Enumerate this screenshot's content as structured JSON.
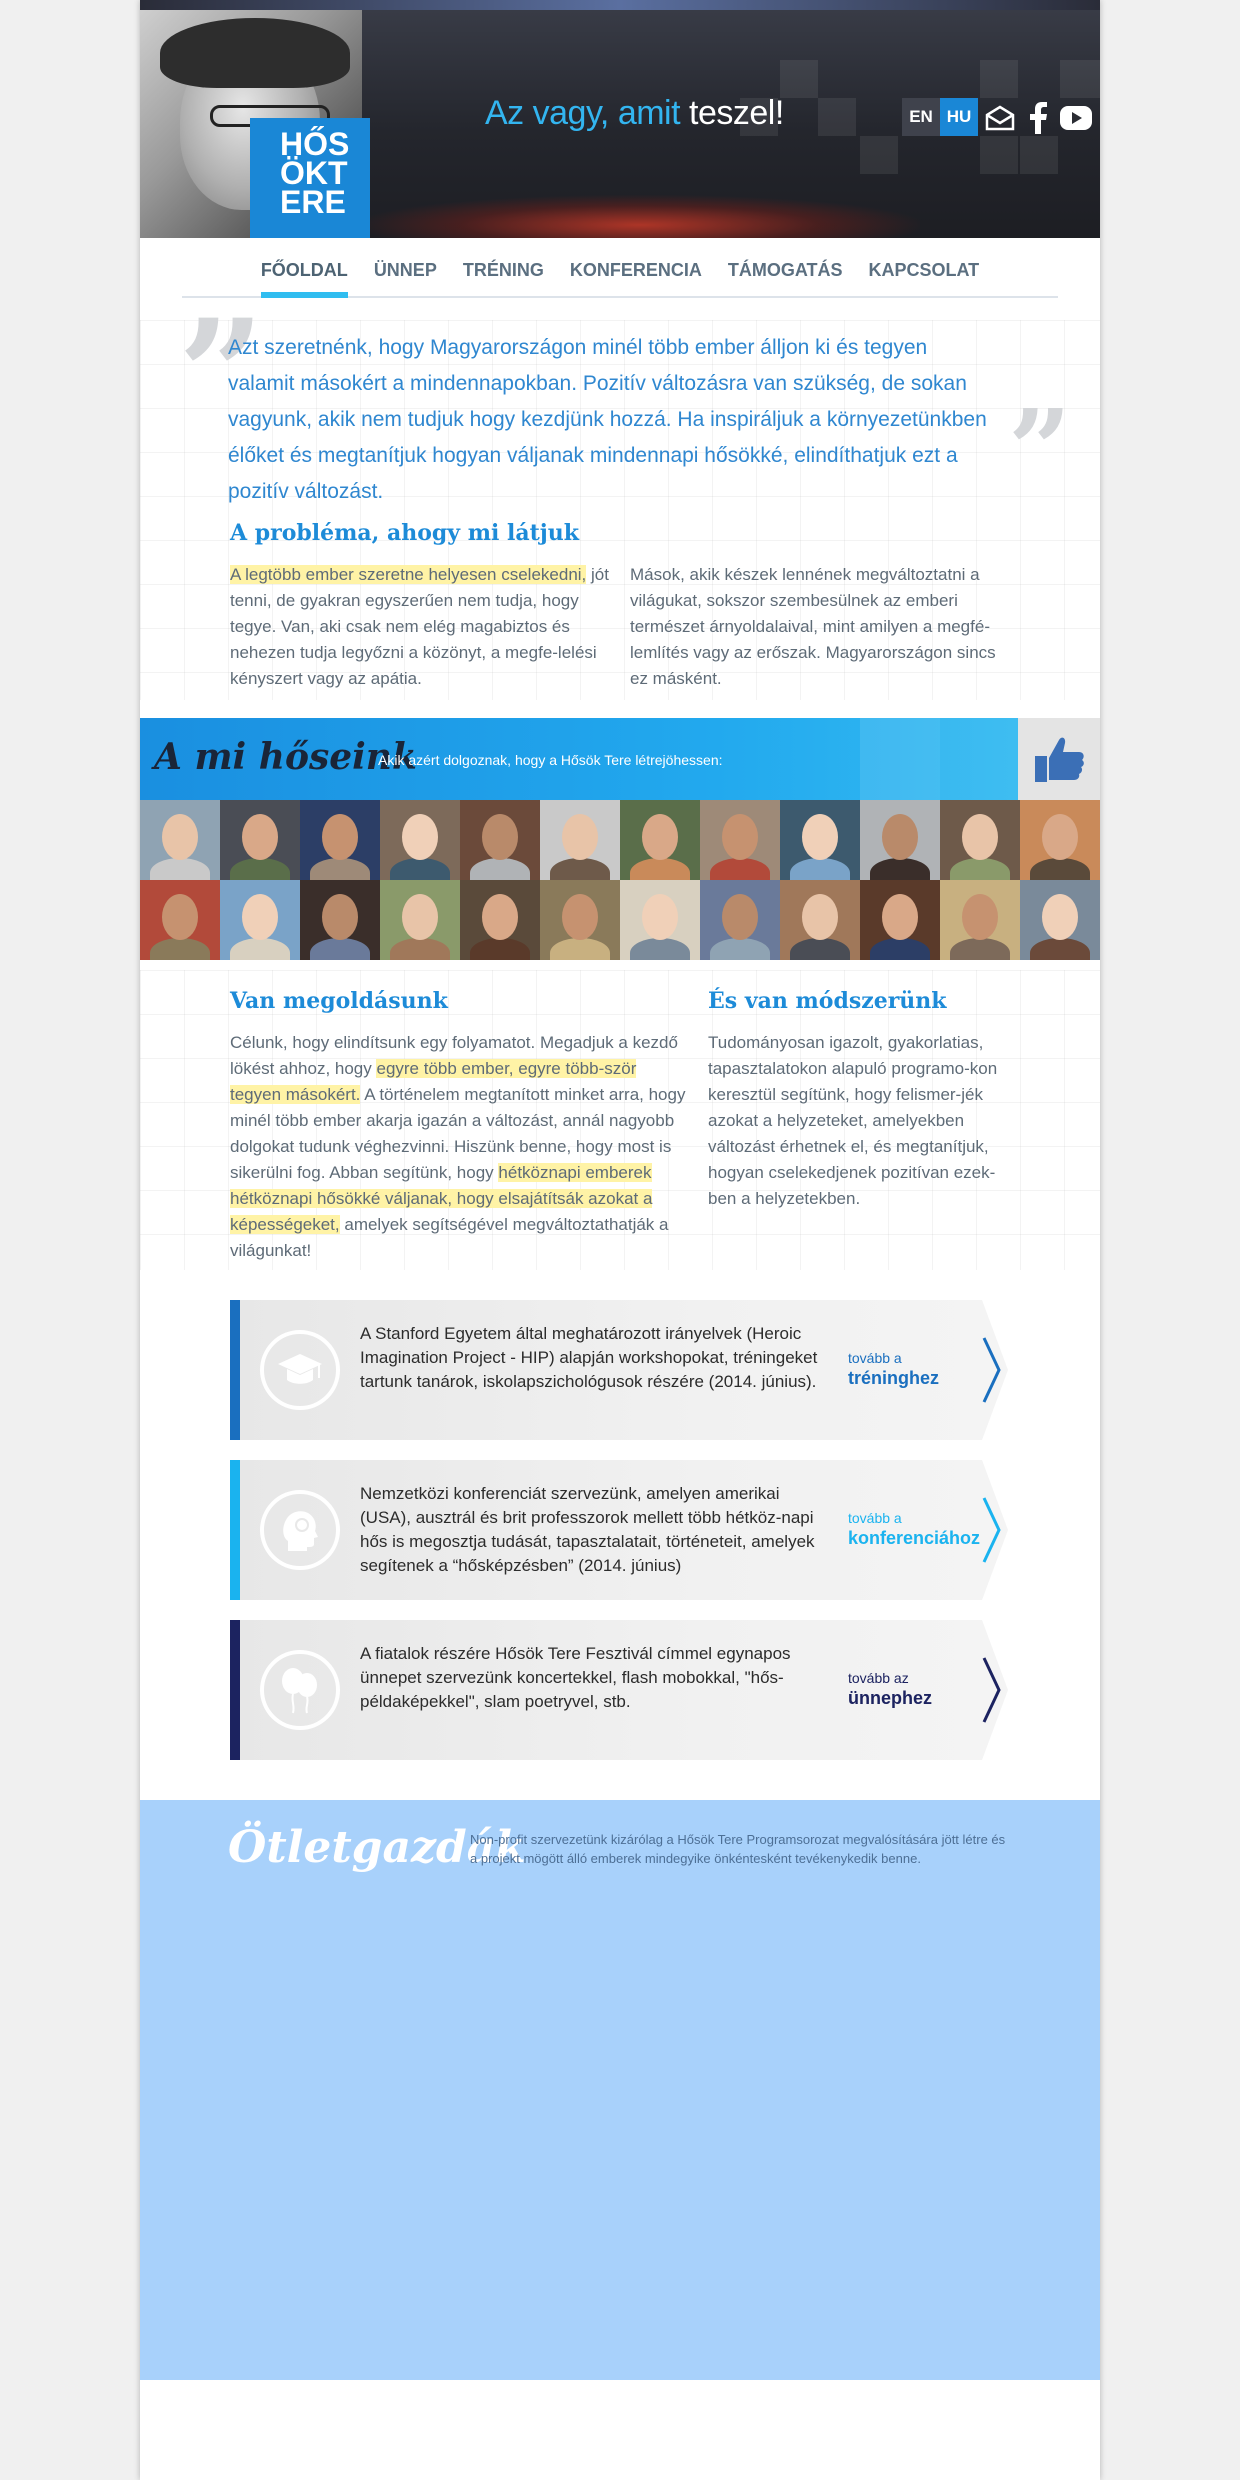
{
  "header": {
    "logo_lines": [
      "HŐS",
      "ÖKT",
      "ERE"
    ],
    "tagline_part1": "Az vagy,",
    "tagline_part2": "amit",
    "tagline_part3": "teszel!",
    "languages": [
      {
        "label": "EN",
        "active": false
      },
      {
        "label": "HU",
        "active": true
      }
    ],
    "social_icons": [
      "mail-icon",
      "facebook-icon",
      "youtube-icon"
    ]
  },
  "nav": {
    "items": [
      {
        "label": "FŐOLDAL",
        "active": true
      },
      {
        "label": "ÜNNEP",
        "active": false
      },
      {
        "label": "TRÉNING",
        "active": false
      },
      {
        "label": "KONFERENCIA",
        "active": false
      },
      {
        "label": "TÁMOGATÁS",
        "active": false
      },
      {
        "label": "KAPCSOLAT",
        "active": false
      }
    ]
  },
  "intro": {
    "quote": "Azt szeretnénk, hogy Magyarországon minél több ember álljon ki és tegyen valamit másokért a mindennapokban. Pozitív változásra van szükség, de sokan vagyunk, akik nem tudjuk hogy kezdjünk hozzá. Ha inspiráljuk a környezetünkben élőket és megtanítjuk hogyan váljanak mindennapi hősökké, elindíthatjuk ezt a pozitív változást."
  },
  "problem": {
    "heading": "A probléma, ahogy mi látjuk",
    "col1_highlight": "A legtöbb ember szeretne helyesen cselekedni,",
    "col1_rest": " jót tenni, de gyakran egyszerűen nem tudja, hogy tegye. Van, aki csak nem elég magabiztos és nehezen tudja legyőzni a közönyt, a megfe-lelési kényszert vagy az apátia.",
    "col2": "Mások, akik készek lennének megváltoztatni a világukat, sokszor szembesülnek az emberi természet árnyoldalaival, mint amilyen a megfé-lemlítés vagy az erőszak. Magyarországon sincs ez másként."
  },
  "heroes": {
    "title": "A mi hőseink",
    "subtitle": "Akik azért dolgoznak, hogy a Hősök Tere létrejöhessen:",
    "count": 24
  },
  "solution": {
    "heading": "Van megoldásunk",
    "p1": "Célunk, hogy elindítsunk egy folyamatot. Megadjuk a kezdő lökést ahhoz, hogy ",
    "p1_hl": "egyre több ember, egyre több-ször tegyen másokért.",
    "p2": " A történelem megtanított minket arra, hogy minél több ember akarja igazán a változást, annál nagyobb dolgokat tudunk véghezvinni. Hiszünk benne, hogy most is sikerülni fog. Abban segítünk, hogy ",
    "p2_hl": "hétköznapi emberek hétköznapi hősökké váljanak, hogy elsajátítsák azokat a képességeket,",
    "p3": " amelyek segítségével megváltoztathatják a világunkat!"
  },
  "method": {
    "heading": "És van módszerünk",
    "text": "Tudományosan igazolt, gyakorlatias, tapasztalatokon alapuló programo-kon keresztül segítünk, hogy felismer-jék azokat a helyzeteket, amelyekben változást érhetnek el, és megtanítjuk, hogyan cselekedjenek pozitívan ezek-ben a helyzetekben."
  },
  "cards": [
    {
      "icon": "graduation-cap-icon",
      "accent": "#1a6fbf",
      "text": "A Stanford Egyetem által meghatározott irányelvek (Heroic Imagination Project - HIP) alapján workshopokat, tréningeket tartunk tanárok, iskolapszichológusok részére (2014. június).",
      "more_small": "tovább a",
      "more_big": "tréninghez"
    },
    {
      "icon": "head-icon",
      "accent": "#1ab3ef",
      "text": "Nemzetközi konferenciát szervezünk, amelyen amerikai (USA), ausztrál és brit professzorok mellett több hétköz-napi hős is megosztja tudását, tapasztalatait, történeteit, amelyek segítenek a “hősképzésben” (2014. június)",
      "more_small": "tovább a",
      "more_big": "konferenciához"
    },
    {
      "icon": "balloons-icon",
      "accent": "#1c2360",
      "text": "A fiatalok részére Hősök Tere Fesztivál címmel egynapos ünnepet szervezünk koncertekkel, flash mobokkal, \"hős-példaképekkel\", slam poetryvel, stb.",
      "more_small": "tovább az",
      "more_big": "ünnephez"
    }
  ],
  "footer": {
    "title": "Ötletgazdák",
    "desc": "Non-profit szervezetünk kizárólag a Hősök Tere Programsorozat megvalósítására jött létre és a projekt mögött álló emberek mindegyike önkéntesként tevékenykedik benne."
  }
}
